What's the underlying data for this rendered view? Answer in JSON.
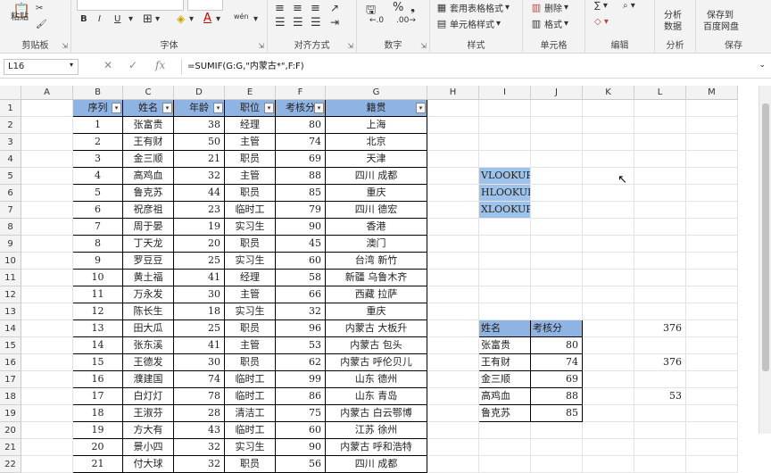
{
  "ribbon": {
    "clipboard": {
      "paste": "粘贴",
      "label": "剪贴板"
    },
    "font": {
      "bold": "B",
      "italic": "I",
      "underline": "U",
      "wen": "wén",
      "label": "字体"
    },
    "alignment": {
      "label": "对齐方式"
    },
    "number": {
      "label": "数字"
    },
    "styles": {
      "table_format": "套用表格格式",
      "cell_style": "单元格样式",
      "label": "样式"
    },
    "cells": {
      "delete": "删除",
      "format": "格式",
      "label": "单元格"
    },
    "editing": {
      "label": "编辑"
    },
    "analysis": {
      "button": "分析\n数据",
      "btn1": "分析",
      "btn2": "数据",
      "label": "分析"
    },
    "save": {
      "btn1": "保存到",
      "btn2": "百度网盘",
      "label": "保存"
    }
  },
  "formula_bar": {
    "name_box": "L16",
    "fx": "fx",
    "formula": "=SUMIF(G:G,\"内蒙古*\",F:F)"
  },
  "columns": [
    "A",
    "B",
    "C",
    "D",
    "E",
    "F",
    "G",
    "H",
    "I",
    "J",
    "K",
    "L",
    "M"
  ],
  "rows": [
    "1",
    "2",
    "3",
    "4",
    "5",
    "6",
    "7",
    "8",
    "9",
    "10",
    "11",
    "12",
    "13",
    "14",
    "15",
    "16",
    "17",
    "18",
    "19",
    "20",
    "21",
    "22"
  ],
  "table": {
    "headers": [
      "序列",
      "姓名",
      "年龄",
      "职位",
      "考核分",
      "籍贯"
    ],
    "rows": [
      [
        "1",
        "张富贵",
        "38",
        "经理",
        "80",
        "上海"
      ],
      [
        "2",
        "王有财",
        "50",
        "主管",
        "74",
        "北京"
      ],
      [
        "3",
        "金三顺",
        "21",
        "职员",
        "69",
        "天津"
      ],
      [
        "4",
        "高鸡血",
        "32",
        "主管",
        "88",
        "四川 成都"
      ],
      [
        "5",
        "鲁克苏",
        "44",
        "职员",
        "85",
        "重庆"
      ],
      [
        "6",
        "祝彦祖",
        "23",
        "临时工",
        "79",
        "四川 德宏"
      ],
      [
        "7",
        "周于晏",
        "19",
        "实习生",
        "90",
        "香港"
      ],
      [
        "8",
        "丁天龙",
        "20",
        "职员",
        "45",
        "澳门"
      ],
      [
        "9",
        "罗豆豆",
        "25",
        "实习生",
        "60",
        "台湾 新竹"
      ],
      [
        "10",
        "黄土福",
        "41",
        "经理",
        "58",
        "新疆 乌鲁木齐"
      ],
      [
        "11",
        "万永发",
        "30",
        "主管",
        "66",
        "西藏 拉萨"
      ],
      [
        "12",
        "陈长生",
        "18",
        "实习生",
        "32",
        "重庆"
      ],
      [
        "13",
        "田大瓜",
        "25",
        "职员",
        "96",
        "内蒙古 大板升"
      ],
      [
        "14",
        "张东溪",
        "41",
        "主管",
        "53",
        "内蒙古 包头"
      ],
      [
        "15",
        "王德发",
        "30",
        "职员",
        "62",
        "内蒙古 呼伦贝儿"
      ],
      [
        "16",
        "濮建国",
        "74",
        "临时工",
        "99",
        "山东 德州"
      ],
      [
        "17",
        "白灯灯",
        "78",
        "临时工",
        "86",
        "山东 青岛"
      ],
      [
        "18",
        "王淑芬",
        "28",
        "清洁工",
        "75",
        "内蒙古 白云鄂博"
      ],
      [
        "19",
        "方大有",
        "43",
        "临时工",
        "60",
        "江苏 徐州"
      ],
      [
        "20",
        "景小四",
        "32",
        "实习生",
        "90",
        "内蒙古 呼和浩特"
      ],
      [
        "21",
        "付大球",
        "32",
        "职员",
        "56",
        "四川 成都"
      ]
    ]
  },
  "lookup_labels": [
    "VLOOKUP",
    "HLOOKUP",
    "XLOOKUP"
  ],
  "small_table": {
    "headers": [
      "姓名",
      "考核分"
    ],
    "rows": [
      [
        "张富贵",
        "80"
      ],
      [
        "王有财",
        "74"
      ],
      [
        "金三顺",
        "69"
      ],
      [
        "高鸡血",
        "88"
      ],
      [
        "鲁克苏",
        "85"
      ]
    ]
  },
  "results": {
    "l14": "376",
    "l16": "376",
    "l18": "53"
  },
  "filter_glyph": "▾"
}
